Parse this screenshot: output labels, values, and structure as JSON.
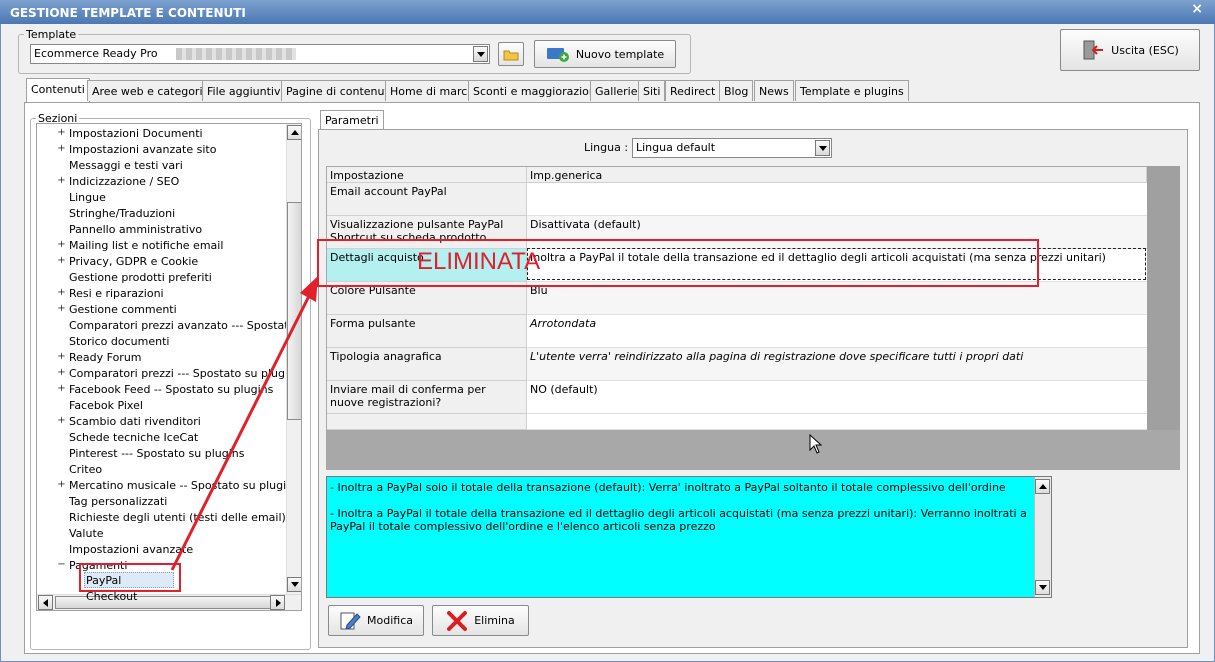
{
  "window": {
    "title": "GESTIONE TEMPLATE E CONTENUTI",
    "close_label": "×"
  },
  "template_group": {
    "legend": "Template",
    "selected": "Ecommerce Ready Pro",
    "new_button": "Nuovo template"
  },
  "exit_button": "Uscita (ESC)",
  "tabs": [
    "Contenuti",
    "Aree web e categorie",
    "File aggiuntivi",
    "Pagine di contenuti",
    "Home di marca",
    "Sconti e maggiorazioni",
    "Gallerie",
    "Siti",
    "Redirect",
    "Blog",
    "News",
    "Template e plugins"
  ],
  "sections": {
    "legend": "Sezioni",
    "items": [
      {
        "label": "Impostazioni Documenti",
        "exp": "+"
      },
      {
        "label": "Impostazioni avanzate sito",
        "exp": "+"
      },
      {
        "label": "Messaggi e testi vari",
        "exp": ""
      },
      {
        "label": "Indicizzazione / SEO",
        "exp": "+"
      },
      {
        "label": "Lingue",
        "exp": ""
      },
      {
        "label": "Stringhe/Traduzioni",
        "exp": ""
      },
      {
        "label": "Pannello amministrativo",
        "exp": ""
      },
      {
        "label": "Mailing list e notifiche email",
        "exp": "+"
      },
      {
        "label": "Privacy, GDPR e Cookie",
        "exp": "+"
      },
      {
        "label": "Gestione prodotti preferiti",
        "exp": ""
      },
      {
        "label": "Resi e riparazioni",
        "exp": "+"
      },
      {
        "label": "Gestione commenti",
        "exp": "+"
      },
      {
        "label": "Comparatori prezzi avanzato --- Spostato su",
        "exp": ""
      },
      {
        "label": "Storico documenti",
        "exp": ""
      },
      {
        "label": "Ready Forum",
        "exp": "+"
      },
      {
        "label": "Comparatori prezzi --- Spostato su plugins",
        "exp": "+"
      },
      {
        "label": "Facebook Feed -- Spostato su plugins",
        "exp": "+"
      },
      {
        "label": "Facebok Pixel",
        "exp": ""
      },
      {
        "label": "Scambio dati rivenditori",
        "exp": "+"
      },
      {
        "label": "Schede tecniche IceCat",
        "exp": ""
      },
      {
        "label": "Pinterest --- Spostato su plugins",
        "exp": ""
      },
      {
        "label": "Criteo",
        "exp": ""
      },
      {
        "label": "Mercatino musicale -- Spostato su plugins",
        "exp": "+"
      },
      {
        "label": "Tag personalizzati",
        "exp": ""
      },
      {
        "label": "Richieste degli utenti (testi delle email)",
        "exp": ""
      },
      {
        "label": "Valute",
        "exp": ""
      },
      {
        "label": "Impostazioni avanzate",
        "exp": ""
      },
      {
        "label": "Pagamenti",
        "exp": "−"
      }
    ],
    "selected_child": "PayPal Checkout"
  },
  "params_tab": "Parametri",
  "language": {
    "label": "Lingua :",
    "selected": "Lingua default"
  },
  "grid": {
    "header": {
      "label": "Impostazione",
      "value": "Imp.generica"
    },
    "rows": [
      {
        "label": "Email account PayPal",
        "value": "",
        "italic": false
      },
      {
        "label": "Visualizzazione pulsante PayPal Shortcut su scheda prodotto",
        "value": "Disattivata (default)",
        "italic": false
      },
      {
        "label": "Dettagli acquisto",
        "value": "Inoltra a PayPal il totale della transazione ed il dettaglio degli articoli acquistati (ma senza prezzi unitari)",
        "italic": false
      },
      {
        "label": "Colore Pulsante",
        "value": "Blu",
        "italic": false
      },
      {
        "label": "Forma pulsante",
        "value": "Arrotondata",
        "italic": true
      },
      {
        "label": "Tipologia anagrafica",
        "value": "L'utente verra' reindirizzato alla pagina di registrazione dove specificare tutti i propri dati",
        "italic": true
      },
      {
        "label": "Inviare mail di conferma per nuove registrazioni?",
        "value": "NO (default)",
        "italic": false
      }
    ]
  },
  "annotation": {
    "text": "ELIMINATA",
    "color": "#e0202a"
  },
  "description": {
    "line1": "- Inoltra a PayPal solo il totale della transazione (default): Verra' inoltrato a PayPal soltanto il totale complessivo dell'ordine",
    "line2": "- Inoltra a PayPal il totale della transazione ed il dettaglio degli articoli acquistati (ma senza prezzi unitari): Verranno inoltrati a PayPal il totale complessivo dell'ordine e l'elenco articoli senza prezzo"
  },
  "actions": {
    "edit": "Modifica",
    "delete": "Elimina"
  },
  "colors": {
    "title_bar": "#4a77b3",
    "highlight": "#00ffff",
    "selected_label": "#b4f0f0",
    "annotation": "#e0202a"
  }
}
